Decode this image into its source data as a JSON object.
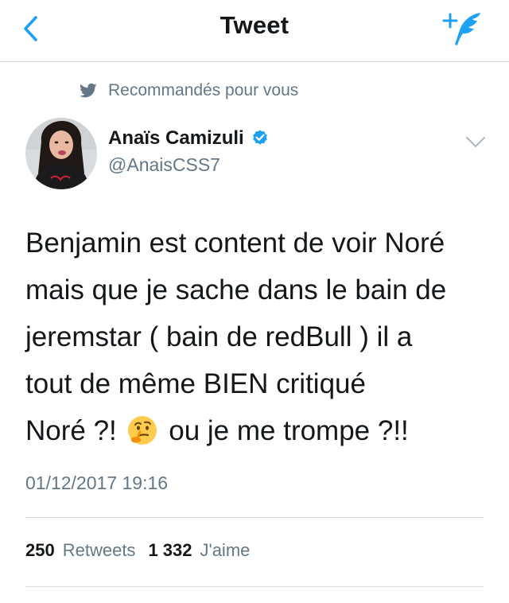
{
  "header": {
    "title": "Tweet",
    "back_icon": "chevron-left-icon",
    "compose_icon": "compose-quill-icon",
    "accent_color": "#1da1f2"
  },
  "recommendation": {
    "icon": "twitter-bird-icon",
    "label": "Recommandés pour vous"
  },
  "author": {
    "display_name": "Anaïs Camizuli",
    "handle": "@AnaisCSS7",
    "verified": true,
    "avatar_icon": "avatar-photo"
  },
  "tweet": {
    "lines": [
      "Benjamin est content de voir Noré",
      "mais que je sache dans le bain de",
      "jeremstar ( bain de redBull ) il a",
      "tout de même BIEN critiqué"
    ],
    "last_line_before_emoji": "Noré ?!",
    "emoji": "🤔",
    "last_line_after_emoji": "ou je me trompe ?!!",
    "timestamp": "01/12/2017 19:16"
  },
  "stats": {
    "retweets_count": "250",
    "retweets_label": "Retweets",
    "likes_count": "1 332",
    "likes_label": "J'aime"
  }
}
